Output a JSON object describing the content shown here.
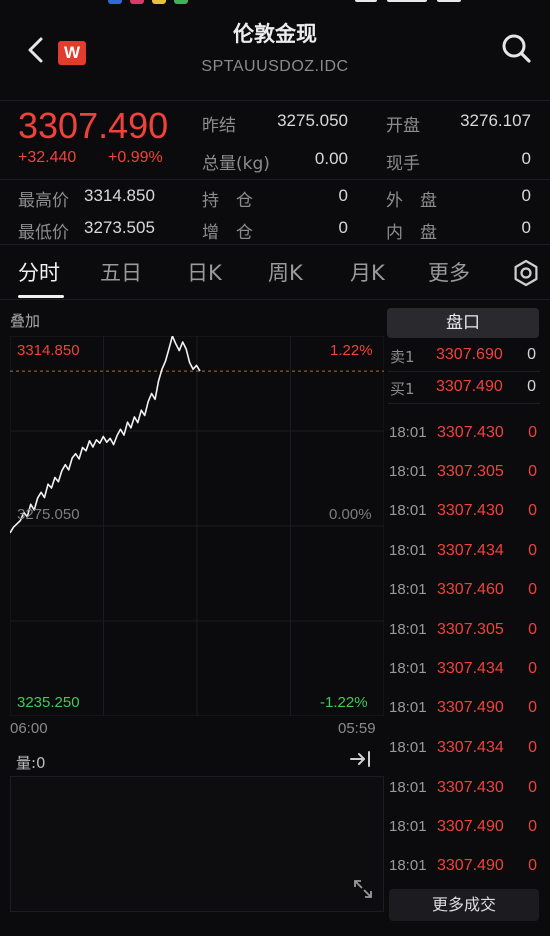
{
  "header": {
    "title": "伦敦金现",
    "subtitle": "SPTAUUSDOZ.IDC",
    "logo_text": "W"
  },
  "quote": {
    "price": "3307.490",
    "change": "+32.440",
    "change_pct": "+0.99%",
    "prev_close_label": "昨结",
    "prev_close": "3275.050",
    "open_label": "开盘",
    "open": "3276.107",
    "volume_label": "总量(kg)",
    "volume": "0.00",
    "current_hand_label": "现手",
    "current_hand": "0",
    "high_label": "最高价",
    "high": "3314.850",
    "position_label": "持　仓",
    "position": "0",
    "outer_label": "外　盘",
    "outer": "0",
    "low_label": "最低价",
    "low": "3273.505",
    "add_position_label": "增　仓",
    "add_position": "0",
    "inner_label": "内　盘",
    "inner": "0"
  },
  "tabs": [
    {
      "label": "分时",
      "active": true
    },
    {
      "label": "五日"
    },
    {
      "label": "日K"
    },
    {
      "label": "周K"
    },
    {
      "label": "月K"
    },
    {
      "label": "更多"
    }
  ],
  "chart": {
    "overlay_label": "叠加",
    "top_price": "3314.850",
    "top_pct": "1.22%",
    "mid_price": "3275.050",
    "mid_pct": "0.00%",
    "bottom_price": "3235.250",
    "bottom_pct": "-1.22%",
    "x_start": "06:00",
    "x_end": "05:59",
    "volume_label": "量:0"
  },
  "chart_data": {
    "type": "line",
    "ylim": [
      3235.25,
      3314.85
    ],
    "reference": 3275.05,
    "values": [
      3273.6,
      3274.8,
      3275.5,
      3276.2,
      3277.9,
      3277.0,
      3279.6,
      3278.4,
      3280.9,
      3282.1,
      3281.0,
      3283.8,
      3283.0,
      3285.2,
      3284.3,
      3286.6,
      3287.9,
      3286.8,
      3289.3,
      3290.2,
      3289.1,
      3291.5,
      3290.8,
      3292.9,
      3291.6,
      3293.1,
      3292.4,
      3293.8,
      3292.6,
      3293.4,
      3292.1,
      3294.0,
      3295.3,
      3294.1,
      3296.8,
      3295.6,
      3297.9,
      3296.7,
      3299.3,
      3298.2,
      3301.1,
      3302.8,
      3301.6,
      3305.4,
      3307.9,
      3309.6,
      3312.1,
      3314.85,
      3313.2,
      3311.8,
      3313.6,
      3312.1,
      3309.3,
      3307.9,
      3308.7,
      3307.49
    ]
  },
  "order_book": {
    "title": "盘口",
    "asks": [
      {
        "label": "卖1",
        "price": "3307.690",
        "qty": "0"
      }
    ],
    "bids": [
      {
        "label": "买1",
        "price": "3307.490",
        "qty": "0"
      }
    ]
  },
  "trades": [
    {
      "time": "18:01",
      "price": "3307.430",
      "qty": "0"
    },
    {
      "time": "18:01",
      "price": "3307.305",
      "qty": "0"
    },
    {
      "time": "18:01",
      "price": "3307.430",
      "qty": "0"
    },
    {
      "time": "18:01",
      "price": "3307.434",
      "qty": "0"
    },
    {
      "time": "18:01",
      "price": "3307.460",
      "qty": "0"
    },
    {
      "time": "18:01",
      "price": "3307.305",
      "qty": "0"
    },
    {
      "time": "18:01",
      "price": "3307.434",
      "qty": "0"
    },
    {
      "time": "18:01",
      "price": "3307.490",
      "qty": "0"
    },
    {
      "time": "18:01",
      "price": "3307.434",
      "qty": "0"
    },
    {
      "time": "18:01",
      "price": "3307.430",
      "qty": "0"
    },
    {
      "time": "18:01",
      "price": "3307.490",
      "qty": "0"
    },
    {
      "time": "18:01",
      "price": "3307.490",
      "qty": "0"
    }
  ],
  "more_trades_label": "更多成交",
  "colors": {
    "up": "#f0423a",
    "down": "#3ccb5a",
    "background": "#0b0b0d"
  }
}
